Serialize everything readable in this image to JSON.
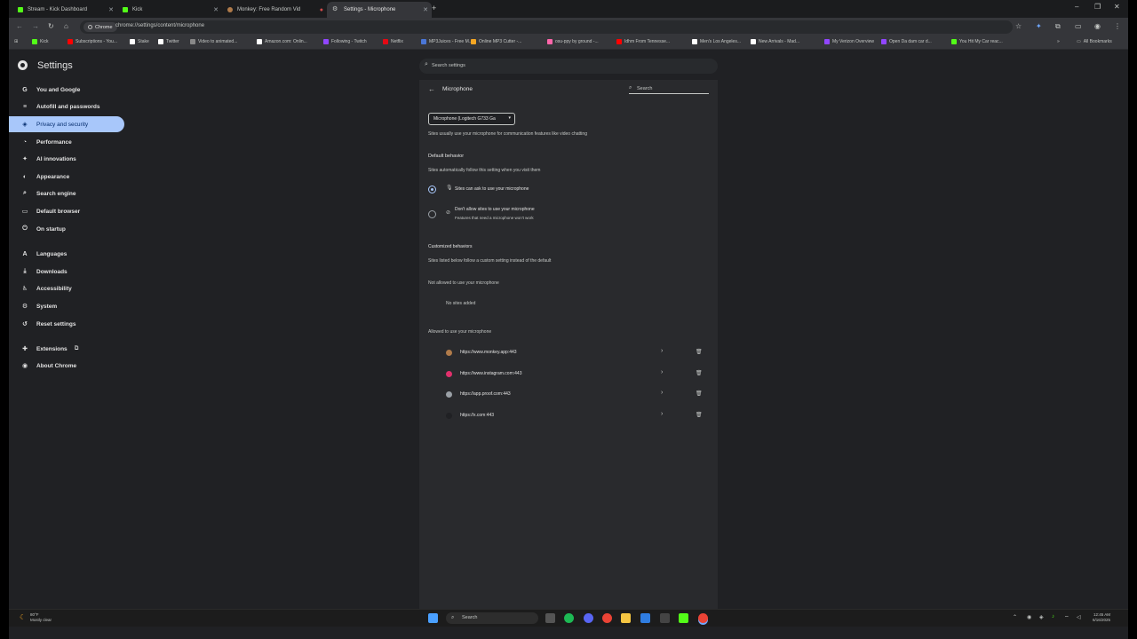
{
  "tabs": [
    {
      "title": "Stream - Kick Dashboard",
      "fav_color": "#53fc18"
    },
    {
      "title": "Kick",
      "fav_color": "#53fc18"
    },
    {
      "title": "Monkey: Free Random Vid",
      "fav_color": "#b07b4a"
    },
    {
      "title": "Settings - Microphone",
      "fav_color": "#c4c7c5"
    }
  ],
  "window": {
    "minimize": "–",
    "maximize": "❐",
    "close": "✕"
  },
  "address": {
    "chip": "Chrome",
    "url": "chrome://settings/content/microphone"
  },
  "bookmarks": [
    {
      "label": "Kick",
      "color": "#53fc18"
    },
    {
      "label": "Subscriptions - You...",
      "color": "#ff0000"
    },
    {
      "label": "Stake",
      "color": "#ffffff"
    },
    {
      "label": "Twitter",
      "color": "#ffffff"
    },
    {
      "label": "Video to animated...",
      "color": "#888888"
    },
    {
      "label": "Amazon.com: Onlin...",
      "color": "#ffffff"
    },
    {
      "label": "Following - Twitch",
      "color": "#9146ff"
    },
    {
      "label": "Netflix",
      "color": "#e50914"
    },
    {
      "label": "MP3Juices - Free M...",
      "color": "#4a76d6"
    },
    {
      "label": "Online MP3 Cutter -...",
      "color": "#f4a623"
    },
    {
      "label": "osu-ppy by ground -...",
      "color": "#ff66aa"
    },
    {
      "label": "Idhm From Tennesse...",
      "color": "#ff0000"
    },
    {
      "label": "Men's Los Angeles...",
      "color": "#ffffff"
    },
    {
      "label": "New Arrivals - Mad...",
      "color": "#ffffff"
    },
    {
      "label": "My Verizon Overview",
      "color": "#9146ff"
    },
    {
      "label": "Open Da dam car d...",
      "color": "#9146ff"
    },
    {
      "label": "You Hit My Car reac...",
      "color": "#53fc18"
    }
  ],
  "bookmarks_all": "All Bookmarks",
  "settings": {
    "title": "Settings",
    "search_placeholder": "Search settings"
  },
  "sidebar": {
    "items": [
      {
        "label": "You and Google",
        "icon": "G"
      },
      {
        "label": "Autofill and passwords",
        "icon": "≡"
      },
      {
        "label": "Privacy and security",
        "icon": "◈",
        "active": true
      },
      {
        "label": "Performance",
        "icon": "◔"
      },
      {
        "label": "AI innovations",
        "icon": "✦"
      },
      {
        "label": "Appearance",
        "icon": "◐"
      },
      {
        "label": "Search engine",
        "icon": "⌕"
      },
      {
        "label": "Default browser",
        "icon": "▭"
      },
      {
        "label": "On startup",
        "icon": "⏻"
      },
      {
        "label": "Languages",
        "icon": "A"
      },
      {
        "label": "Downloads",
        "icon": "⤓"
      },
      {
        "label": "Accessibility",
        "icon": "♿"
      },
      {
        "label": "System",
        "icon": "⚙"
      },
      {
        "label": "Reset settings",
        "icon": "↺"
      },
      {
        "label": "Extensions",
        "icon": "✚"
      },
      {
        "label": "About Chrome",
        "icon": "◉"
      }
    ]
  },
  "page": {
    "title": "Microphone",
    "search_placeholder": "Search",
    "mic_device": "Microphone (Logitech G733 Ga",
    "mic_description": "Sites usually use your microphone for communication features like video chatting",
    "default_behavior": {
      "heading": "Default behavior",
      "subtext": "Sites automatically follow this setting when you visit them",
      "option_allow": "Sites can ask to use your microphone",
      "option_block": "Don't allow sites to use your microphone",
      "option_block_sub": "Features that need a microphone won't work"
    },
    "customized": {
      "heading": "Customized behaviors",
      "subtext": "Sites listed below follow a custom setting instead of the default",
      "not_allowed_heading": "Not allowed to use your microphone",
      "no_sites": "No sites added",
      "allowed_heading": "Allowed to use your microphone",
      "allowed_sites": [
        {
          "url": "https://www.monkey.app:443",
          "color": "#b07b4a"
        },
        {
          "url": "https://www.instagram.com:443",
          "color": "#e1306c"
        },
        {
          "url": "https://app.proof.com:443",
          "color": "#9aa0a6"
        },
        {
          "url": "https://x.com:443",
          "color": "#202124"
        }
      ]
    }
  },
  "taskbar": {
    "weather_temp": "80°F",
    "weather_desc": "Mostly clear",
    "search": "Search",
    "time": "12:45 AM",
    "date": "6/16/2025"
  }
}
